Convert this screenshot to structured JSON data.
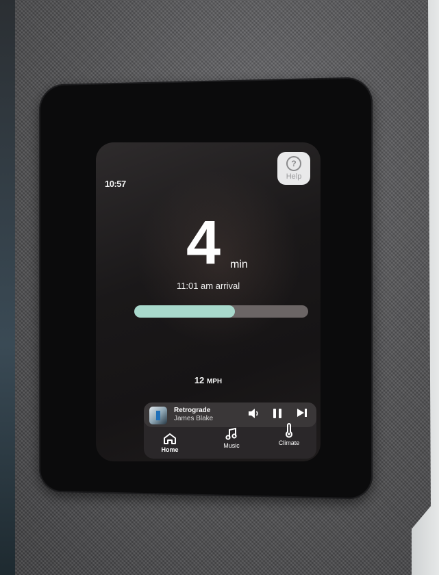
{
  "status_bar": {
    "time": "10:57"
  },
  "help": {
    "icon": "question-circle-icon",
    "label": "Help"
  },
  "trip": {
    "eta_value": "4",
    "eta_unit": "min",
    "arrival": "11:01 am arrival",
    "progress_percent": 58,
    "speed_value": "12",
    "speed_unit": "MPH"
  },
  "media": {
    "title": "Retrograde",
    "artist": "James Blake",
    "controls": [
      {
        "name": "volume-icon",
        "glyph": "🔈"
      },
      {
        "name": "pause-icon",
        "glyph": "❚❚"
      },
      {
        "name": "next-track-icon",
        "glyph": "⏭"
      }
    ]
  },
  "nav": {
    "items": [
      {
        "label": "Home",
        "icon": "home-icon"
      },
      {
        "label": "Music",
        "icon": "music-note-icon"
      },
      {
        "label": "Climate",
        "icon": "thermometer-icon"
      }
    ]
  },
  "colors": {
    "progress_fill": "#a8d9cc",
    "progress_track": "#6b6565",
    "screen_bg": "#1a1819"
  }
}
